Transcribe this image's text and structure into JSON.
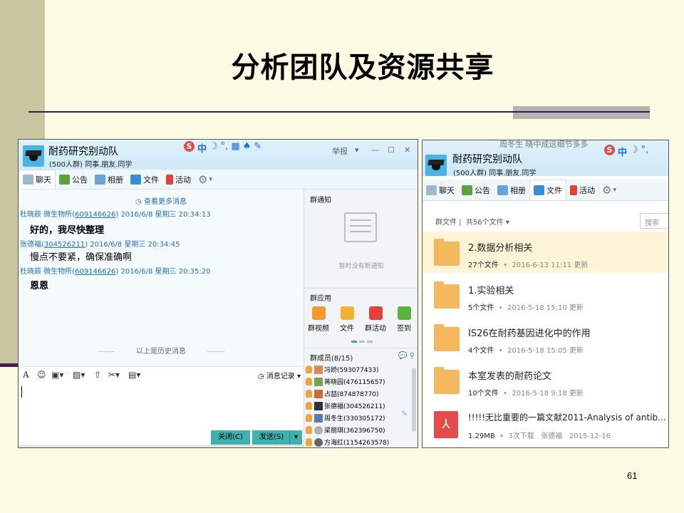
{
  "slide": {
    "title": "分析团队及资源共享",
    "page_number": "61"
  },
  "chat_window": {
    "group_name": "耐药研究别动队",
    "group_desc": "(500人群) 同事.朋友.同学",
    "top_right": "举报",
    "tabs": [
      "聊天",
      "公告",
      "相册",
      "文件",
      "活动"
    ],
    "more_messages": "查看更多消息",
    "messages": [
      {
        "sender": "杜晓辰 微生物所(",
        "qq": "609146626",
        "time": ") 2016/6/8 星期三 20:34:13",
        "text": "好的，我尽快整理"
      },
      {
        "sender": "张德福(",
        "qq": "304526211",
        "time": ") 2016/6/8 星期三 20:34:45",
        "text": "慢点不要紧，确保准确啊"
      },
      {
        "sender": "杜晓辰 微生物所(",
        "qq": "609146626",
        "time": ") 2016/6/8 星期三 20:35:20",
        "text": "恩恩"
      }
    ],
    "history_label": "以上是历史消息",
    "msg_record": "消息记录",
    "close_button": "关闭(C)",
    "send_button": "发送(S)",
    "notice_title": "群通知",
    "notice_empty": "暂时没有新通知",
    "apps_title": "群应用",
    "apps": [
      {
        "label": "群视频",
        "color": "#f39a2c"
      },
      {
        "label": "文件",
        "color": "#f4b232"
      },
      {
        "label": "群活动",
        "color": "#e2423b"
      },
      {
        "label": "签到",
        "color": "#5bb53a"
      }
    ],
    "members_title": "群成员(8/15)",
    "members": [
      "冯娇(593077433)",
      "蒋晓园(476115657)",
      "占喆(874878770)",
      "张德福(304526211)",
      "周冬生(330305172)",
      "梁丽琪(362396750)",
      "方海红(1154263578)"
    ]
  },
  "files_window": {
    "cut_text": "周冬生 晓中成这细节多多",
    "group_name": "耐药研究别动队",
    "group_desc": "(500人群) 同事.朋友.同学",
    "tabs": [
      "聊天",
      "公告",
      "相册",
      "文件",
      "活动"
    ],
    "crumb_root": "群文件",
    "crumb_count": "共56个文件",
    "search_placeholder": "搜索",
    "files": [
      {
        "name": "2.数据分析相关",
        "count": "27个文件",
        "date": "2016-6-13 11:11 更新",
        "type": "folder"
      },
      {
        "name": "1.实验相关",
        "count": "5个文件",
        "date": "2016-5-18 15:10 更新",
        "type": "folder"
      },
      {
        "name": "IS26在耐药基因进化中的作用",
        "count": "4个文件",
        "date": "2016-5-18 15:05 更新",
        "type": "folder"
      },
      {
        "name": "本室发表的耐药论文",
        "count": "10个文件",
        "date": "2016-5-18 9:18 更新",
        "type": "folder"
      },
      {
        "name": "!!!!!无比重要的一篇文献2011-Analysis of antib...",
        "count": "1.29MB",
        "date": "3次下载",
        "uploader": "张德福",
        "upload_date": "2015-12-16",
        "type": "pdf"
      }
    ]
  },
  "colors": {
    "slide_bg": "#fdfbe3",
    "accent_teal": "#3fb1ae",
    "link_blue": "#1f6fb5",
    "folder_orange": "#f4b85f",
    "pdf_red": "#e54b4b"
  }
}
